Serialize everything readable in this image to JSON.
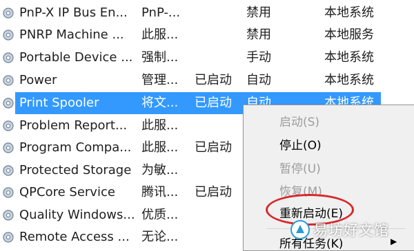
{
  "services": [
    {
      "name": "PnP-X IP Bus En...",
      "description": "PnP-...",
      "status": "",
      "startup": "禁用",
      "logon": "本地系统"
    },
    {
      "name": "PNRP Machine ...",
      "description": "此服...",
      "status": "",
      "startup": "禁用",
      "logon": "本地服务"
    },
    {
      "name": "Portable Device ...",
      "description": "强制...",
      "status": "",
      "startup": "手动",
      "logon": "本地系统"
    },
    {
      "name": "Power",
      "description": "管理...",
      "status": "已启动",
      "startup": "自动",
      "logon": "本地系统"
    },
    {
      "name": "Print Spooler",
      "description": "将文...",
      "status": "已启动",
      "startup": "自动",
      "logon": "本地系统"
    },
    {
      "name": "Problem Report...",
      "description": "此服...",
      "status": "",
      "startup": "",
      "logon": ""
    },
    {
      "name": "Program Compa...",
      "description": "此服...",
      "status": "已启动",
      "startup": "",
      "logon": ""
    },
    {
      "name": "Protected Storage",
      "description": "为敏...",
      "status": "",
      "startup": "",
      "logon": ""
    },
    {
      "name": "QPCore Service",
      "description": "腾讯...",
      "status": "已启动",
      "startup": "",
      "logon": ""
    },
    {
      "name": "Quality Windows...",
      "description": "优质...",
      "status": "",
      "startup": "",
      "logon": ""
    },
    {
      "name": "Remote Access ...",
      "description": "无论...",
      "status": "",
      "startup": "",
      "logon": ""
    }
  ],
  "selected_service": "Print Spooler",
  "context_menu": {
    "items": [
      {
        "label": "启动(S)",
        "enabled": false
      },
      {
        "label": "停止(O)",
        "enabled": true
      },
      {
        "label": "暂停(U)",
        "enabled": false
      },
      {
        "label": "恢复(M)",
        "enabled": false
      },
      {
        "label": "重新启动(E)",
        "enabled": true
      },
      {
        "label": "所有任务(K)",
        "enabled": true
      }
    ]
  },
  "watermark": {
    "text": "易坊好文馆"
  },
  "colors": {
    "selection": "#3399ff",
    "highlight_ellipse": "#d8282b",
    "menu_bg": "#f0f0f0"
  }
}
